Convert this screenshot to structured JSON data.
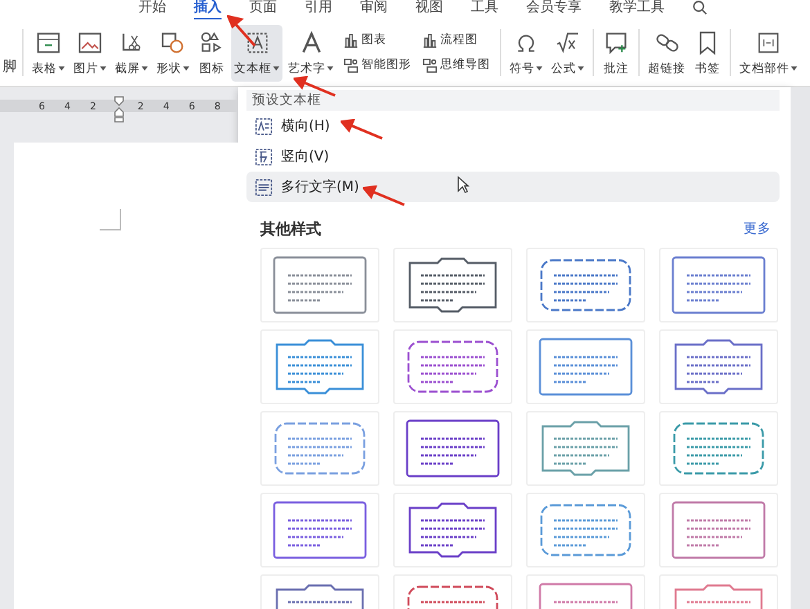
{
  "tabs": [
    {
      "label": "开始",
      "selected": false
    },
    {
      "label": "插入",
      "selected": true
    },
    {
      "label": "页面",
      "selected": false
    },
    {
      "label": "引用",
      "selected": false
    },
    {
      "label": "审阅",
      "selected": false
    },
    {
      "label": "视图",
      "selected": false
    },
    {
      "label": "工具",
      "selected": false
    },
    {
      "label": "会员专享",
      "selected": false
    },
    {
      "label": "教学工具",
      "selected": false
    }
  ],
  "ribbon_groups": [
    [
      {
        "kind": "label",
        "label": "脚"
      }
    ],
    [
      {
        "kind": "large",
        "label": "表格",
        "dropdown": true,
        "pressed": false
      },
      {
        "kind": "large",
        "label": "图片",
        "dropdown": true,
        "pressed": false
      },
      {
        "kind": "large",
        "label": "截屏",
        "dropdown": true,
        "pressed": false
      },
      {
        "kind": "large",
        "label": "形状",
        "dropdown": true,
        "pressed": false
      },
      {
        "kind": "large",
        "label": "图标",
        "dropdown": false,
        "pressed": false
      },
      {
        "kind": "large",
        "label": "文本框",
        "dropdown": true,
        "pressed": true
      },
      {
        "kind": "large",
        "label": "艺术字",
        "dropdown": true,
        "pressed": false
      },
      {
        "kind": "stack",
        "items": [
          "图表",
          "智能图形"
        ]
      },
      {
        "kind": "stack",
        "items": [
          "流程图",
          "思维导图"
        ]
      }
    ],
    [
      {
        "kind": "large",
        "label": "符号",
        "dropdown": true,
        "pressed": false
      },
      {
        "kind": "large",
        "label": "公式",
        "dropdown": true,
        "pressed": false
      }
    ],
    [
      {
        "kind": "large",
        "label": "批注",
        "dropdown": false,
        "pressed": false
      }
    ],
    [
      {
        "kind": "large",
        "label": "超链接",
        "dropdown": false,
        "pressed": false
      },
      {
        "kind": "large",
        "label": "书签",
        "dropdown": false,
        "pressed": false
      }
    ],
    [
      {
        "kind": "large",
        "label": "文档部件",
        "dropdown": true,
        "pressed": false
      }
    ]
  ],
  "ruler": {
    "ticks": [
      "6",
      "4",
      "2",
      "2",
      "4",
      "6",
      "8"
    ]
  },
  "dropdown": {
    "section_title": "预设文本框",
    "options": [
      {
        "label": "横向(H)",
        "selected": false
      },
      {
        "label": "竖向(V)",
        "selected": false
      },
      {
        "label": "多行文字(M)",
        "selected": true
      }
    ],
    "more_title": "其他样式",
    "more_link": "更多",
    "templates": [
      {
        "color": "#8a8f99"
      },
      {
        "color": "#555c66"
      },
      {
        "color": "#4a78c8"
      },
      {
        "color": "#6b7fd0"
      },
      {
        "color": "#3a8fd8"
      },
      {
        "color": "#9b4fd0"
      },
      {
        "color": "#5a8fd8"
      },
      {
        "color": "#6a6fc8"
      },
      {
        "color": "#7aa0e0"
      },
      {
        "color": "#6a3fc8"
      },
      {
        "color": "#6aa0a8"
      },
      {
        "color": "#3a9aa8"
      },
      {
        "color": "#7a5fe0"
      },
      {
        "color": "#6a3fc8"
      },
      {
        "color": "#5a9ad8"
      },
      {
        "color": "#c07aa8"
      },
      {
        "color": "#6a6fb0"
      },
      {
        "color": "#d04a5a"
      },
      {
        "color": "#d07aa8"
      },
      {
        "color": "#e07a90"
      }
    ]
  }
}
